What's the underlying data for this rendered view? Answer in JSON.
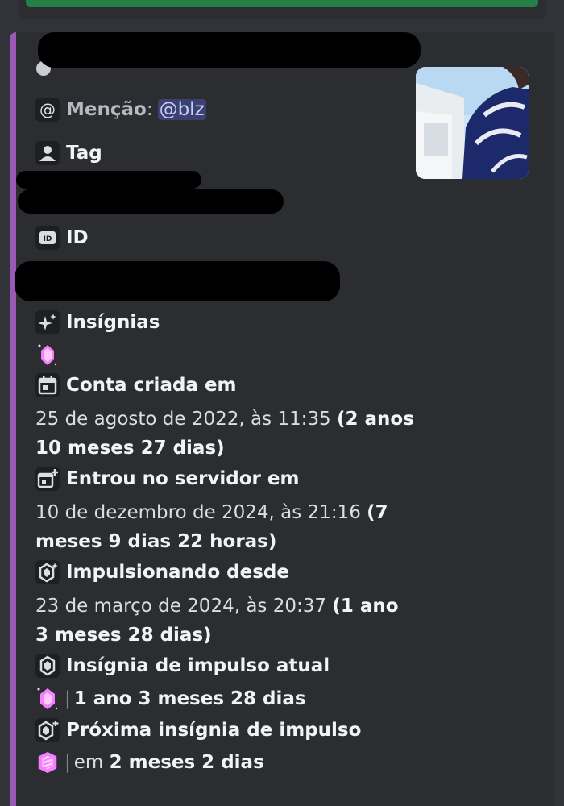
{
  "fields": {
    "mention_label": "Menção",
    "mention_colon": ":",
    "mention_value": "@blz",
    "tag_label": "Tag",
    "id_label": "ID",
    "badges_label": "Insígnias",
    "created_label": "Conta criada em",
    "created_date": "25 de agosto de 2022, às 11:35 ",
    "created_relative": "(2 anos 10 meses 27 dias)",
    "joined_label": "Entrou no servidor em",
    "joined_date": "10 de dezembro de 2024, às 21:16 ",
    "joined_relative": "(7 meses 9 dias 22 horas)",
    "boosting_label": "Impulsionando desde",
    "boosting_date": "23 de março de 2024, às 20:37 ",
    "boosting_relative": "(1 ano 3 meses 28 dias)",
    "current_boost_label": "Insígnia de impulso atual",
    "current_boost_pipe": "|",
    "current_boost_value": "1 ano 3 meses 28 dias",
    "next_boost_label": "Próxima insígnia de impulso",
    "next_boost_pipe": "|",
    "next_boost_prefix": "em ",
    "next_boost_value": "2 meses 2 dias"
  },
  "icons": {
    "mention": "at-sign-icon",
    "tag": "person-icon",
    "id": "id-badge-icon",
    "badges": "sparkles-icon",
    "badge_item": "pink-gem-icon",
    "created": "calendar-icon",
    "joined": "calendar-plus-icon",
    "boosting": "boost-gem-icon",
    "current_boost": "boost-badge-icon",
    "next_boost": "boost-badge-plus-icon"
  },
  "colors": {
    "background": "#313338",
    "embed_background": "#2b2d31",
    "embed_accent": "#9b59b6",
    "button_green": "#248046",
    "mention_bg": "#3c4270",
    "mention_text": "#c9cdfb"
  }
}
